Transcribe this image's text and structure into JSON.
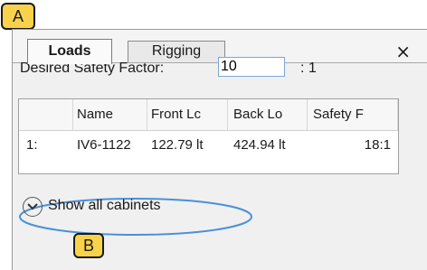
{
  "callouts": {
    "a": "A",
    "b": "B"
  },
  "tabs": [
    {
      "label": "Loads",
      "active": true
    },
    {
      "label": "Rigging",
      "active": false
    }
  ],
  "close_glyph": "×",
  "safety": {
    "label": "Desired Safety Factor:",
    "value": "10",
    "ratio_suffix": ": 1"
  },
  "grid": {
    "headers": [
      "",
      "Name",
      "Front Lc",
      "Back Lo",
      "Safety F"
    ],
    "rows": [
      [
        "1:",
        "IV6-1122",
        "122.79 lt",
        "424.94 lt",
        "18:1"
      ]
    ]
  },
  "show_all": {
    "label": "Show all cabinets",
    "icon": "chevron-down-circle-icon"
  },
  "colors": {
    "callout_fill": "#f9d24c",
    "highlight": "#4a90d9",
    "input_border": "#7aa7d9"
  }
}
